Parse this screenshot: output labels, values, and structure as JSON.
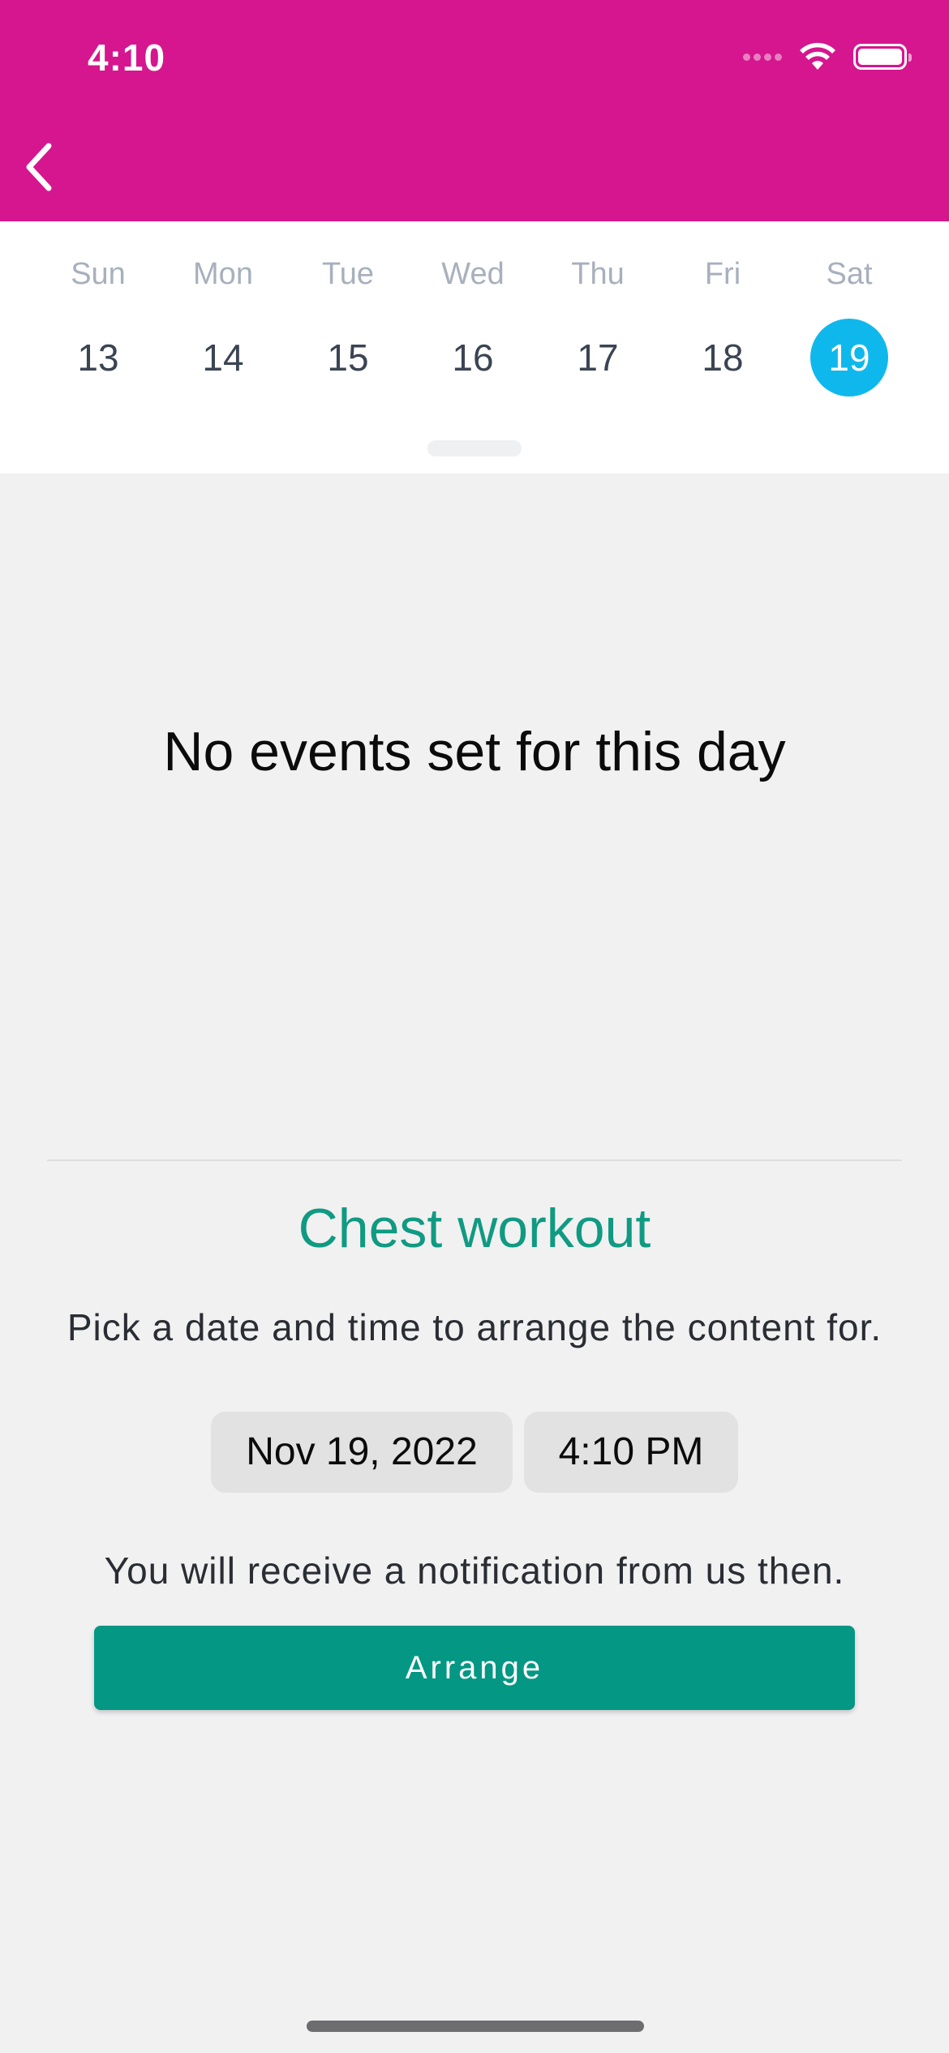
{
  "status_bar": {
    "time": "4:10",
    "wifi_icon": "wifi-icon",
    "battery_icon": "battery-icon"
  },
  "header": {
    "background_color": "#d5168e",
    "back_icon": "chevron-left-icon"
  },
  "week": {
    "days": [
      {
        "name": "Sun",
        "date": "13",
        "selected": false
      },
      {
        "name": "Mon",
        "date": "14",
        "selected": false
      },
      {
        "name": "Tue",
        "date": "15",
        "selected": false
      },
      {
        "name": "Wed",
        "date": "16",
        "selected": false
      },
      {
        "name": "Thu",
        "date": "17",
        "selected": false
      },
      {
        "name": "Fri",
        "date": "18",
        "selected": false
      },
      {
        "name": "Sat",
        "date": "19",
        "selected": true
      }
    ],
    "selected_color": "#0fb8ec"
  },
  "events": {
    "empty_message": "No events set for this day"
  },
  "arrange": {
    "title": "Chest workout",
    "title_color": "#109a82",
    "instructions": "Pick a date and time to arrange the content for.",
    "date_value": "Nov 19, 2022",
    "time_value": "4:10 PM",
    "notice": "You will receive a notification from us then.",
    "button_label": "Arrange",
    "button_color": "#049784"
  }
}
